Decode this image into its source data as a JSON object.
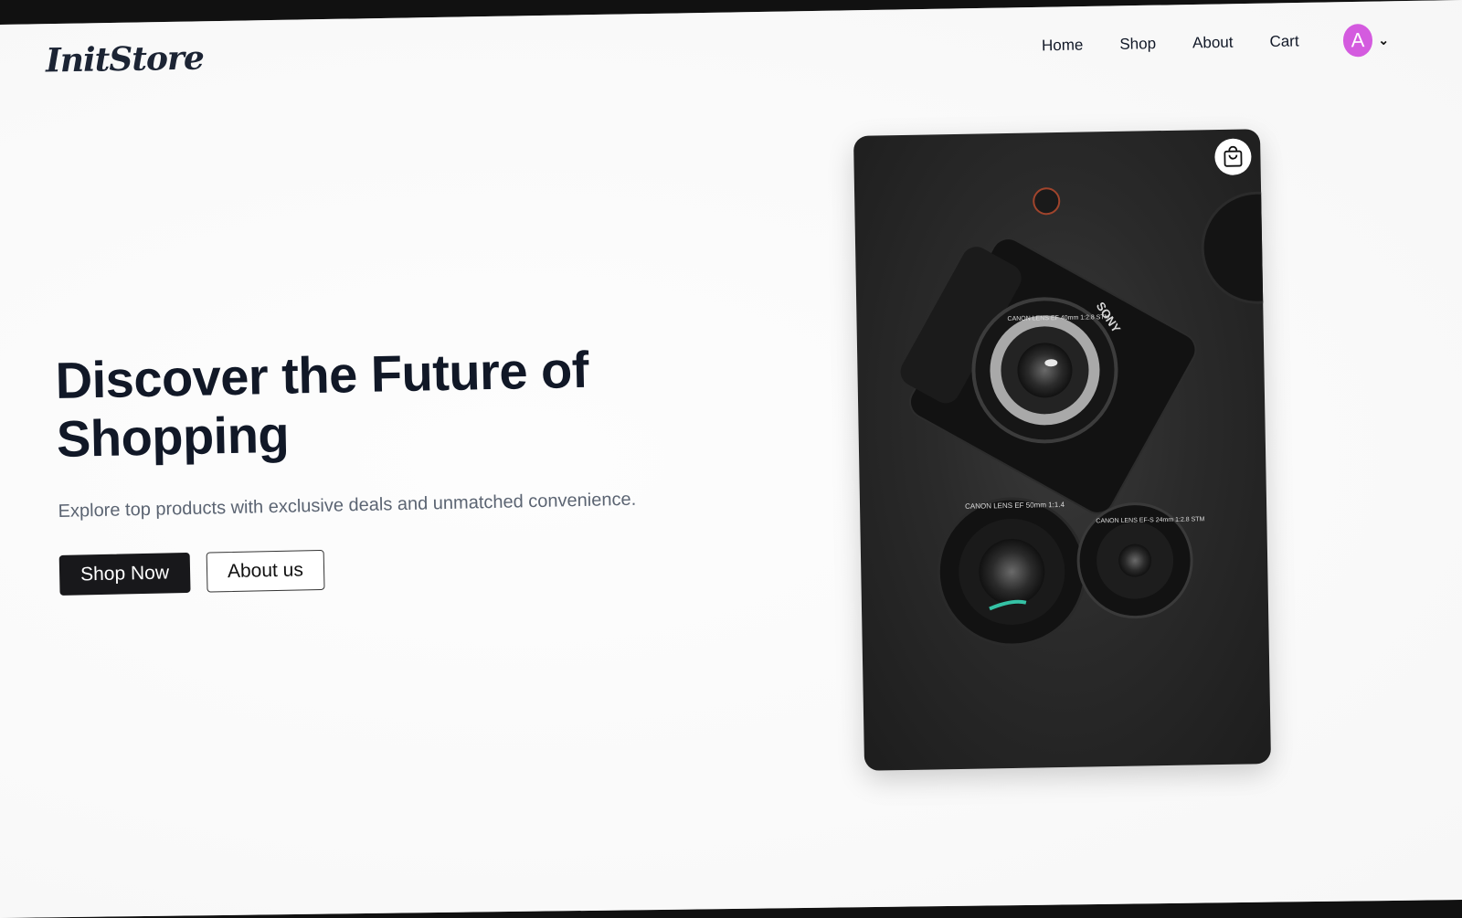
{
  "brand": {
    "logo": "InitStore"
  },
  "nav": {
    "items": [
      {
        "label": "Home"
      },
      {
        "label": "Shop"
      },
      {
        "label": "About"
      },
      {
        "label": "Cart"
      }
    ],
    "avatar_initial": "A"
  },
  "hero": {
    "title_line1": "Discover the Future of",
    "title_line2": "Shopping",
    "subtitle": "Explore top products with exclusive deals and unmatched convenience.",
    "primary_button": "Shop Now",
    "secondary_button": "About us"
  },
  "product_card": {
    "icon": "shopping-bag-icon",
    "camera_brand": "SONY",
    "lens1_text": "CANON LENS EF 40mm 1:2.8 STM",
    "lens2_text": "CANON LENS EF 50mm 1:1.4",
    "lens3_text": "CANON LENS EF-S 24mm 1:2.8 STM"
  },
  "colors": {
    "avatar": "#d45bdf",
    "primary": "#18181b",
    "text": "#111827",
    "muted": "#5b6472"
  }
}
